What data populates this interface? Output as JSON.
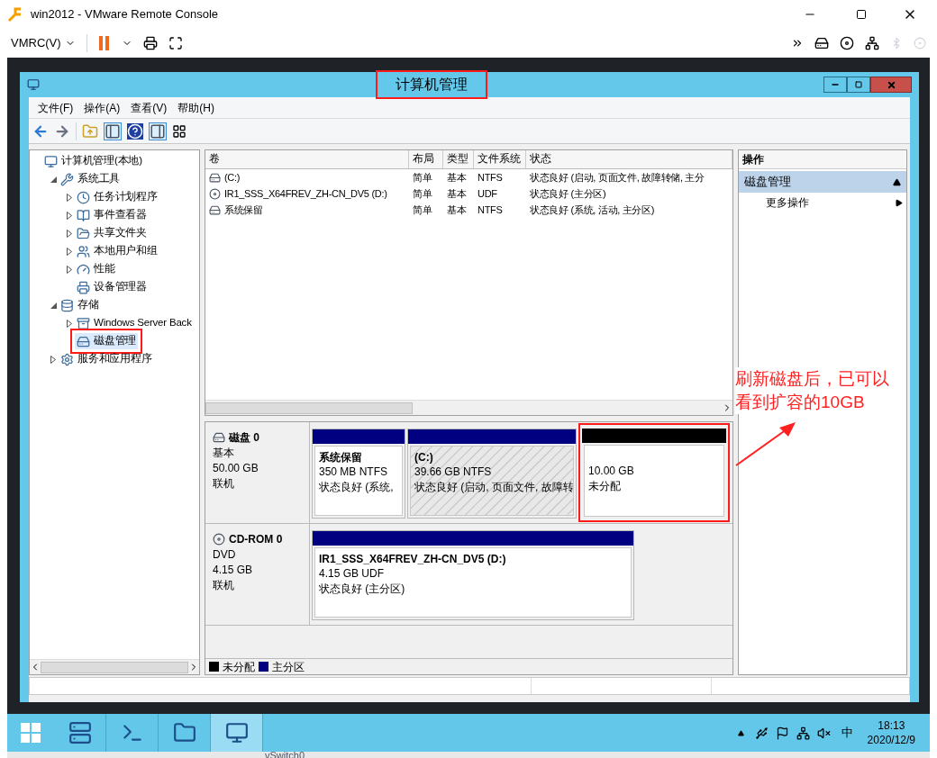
{
  "vmrc": {
    "title": "win2012 - VMware Remote Console",
    "menu": "VMRC(V)"
  },
  "window": {
    "title": "计算机管理",
    "title_highlighted": true,
    "menu": [
      "文件(F)",
      "操作(A)",
      "查看(V)",
      "帮助(H)"
    ],
    "tree": [
      {
        "label": "计算机管理(本地)",
        "selected": false,
        "highlighted": false,
        "children": [
          {
            "label": "系统工具",
            "expanded": true,
            "selected": false,
            "highlighted": false,
            "children": [
              {
                "label": "任务计划程序",
                "expanded": false,
                "selected": false,
                "highlighted": false
              },
              {
                "label": "事件查看器",
                "expanded": false,
                "selected": false,
                "highlighted": false
              },
              {
                "label": "共享文件夹",
                "expanded": false,
                "selected": false,
                "highlighted": false
              },
              {
                "label": "本地用户和组",
                "expanded": false,
                "selected": false,
                "highlighted": false
              },
              {
                "label": "性能",
                "expanded": false,
                "selected": false,
                "highlighted": false
              },
              {
                "label": "设备管理器",
                "selected": false,
                "highlighted": false
              }
            ]
          },
          {
            "label": "存储",
            "expanded": true,
            "selected": false,
            "highlighted": false,
            "children": [
              {
                "label": "Windows Server Back",
                "expanded": false,
                "selected": false,
                "highlighted": false
              },
              {
                "label": "磁盘管理",
                "selected": true,
                "highlighted": true
              }
            ]
          },
          {
            "label": "服务和应用程序",
            "expanded": false,
            "selected": false,
            "highlighted": false
          }
        ]
      }
    ],
    "volumes": {
      "columns": [
        "卷",
        "布局",
        "类型",
        "文件系统",
        "状态"
      ],
      "rows": [
        {
          "cells": [
            "(C:)",
            "简单",
            "基本",
            "NTFS",
            "状态良好 (启动, 页面文件, 故障转储, 主分"
          ],
          "kind": "disk"
        },
        {
          "cells": [
            "IR1_SSS_X64FREV_ZH-CN_DV5 (D:)",
            "简单",
            "基本",
            "UDF",
            "状态良好 (主分区)"
          ],
          "kind": "cd"
        },
        {
          "cells": [
            "系统保留",
            "简单",
            "基本",
            "NTFS",
            "状态良好 (系统, 活动, 主分区)"
          ],
          "kind": "disk"
        }
      ]
    },
    "disks": [
      {
        "name": "磁盘 0",
        "kind": "disk",
        "lines": [
          "基本",
          "50.00 GB",
          "联机"
        ],
        "partitions": [
          {
            "kind": "primary",
            "name": "系统保留",
            "size": "350 MB NTFS",
            "status": "状态良好 (系统,",
            "selected": false,
            "highlighted": false
          },
          {
            "kind": "primary",
            "name": "(C:)",
            "size": "39.66 GB NTFS",
            "status": "状态良好 (启动, 页面文件, 故障转",
            "selected": true,
            "highlighted": false
          },
          {
            "kind": "unallocated",
            "size": "10.00 GB",
            "status": "未分配",
            "selected": false,
            "highlighted": true
          }
        ]
      },
      {
        "name": "CD-ROM 0",
        "kind": "cd",
        "lines": [
          "DVD",
          "4.15 GB",
          "联机"
        ],
        "partitions": [
          {
            "kind": "primary",
            "name": "IR1_SSS_X64FREV_ZH-CN_DV5  (D:)",
            "size": "4.15 GB UDF",
            "status": "状态良好 (主分区)",
            "selected": false,
            "highlighted": false
          }
        ]
      }
    ],
    "legend": [
      {
        "label": "未分配",
        "color": "#000000"
      },
      {
        "label": "主分区",
        "color": "#000080"
      }
    ],
    "actions": {
      "header": "操作",
      "section": "磁盘管理",
      "expanded": true,
      "items": [
        "更多操作"
      ]
    },
    "annotation": "刷新磁盘后，已可以看到扩容的10GB"
  },
  "taskbar": {
    "apps": [
      {
        "selected": false
      },
      {
        "selected": false
      },
      {
        "selected": false
      },
      {
        "selected": true
      }
    ],
    "ime": "中",
    "time": "18:13",
    "date": "2020/12/9"
  },
  "desktop": {
    "strip": "vSwitch0"
  }
}
